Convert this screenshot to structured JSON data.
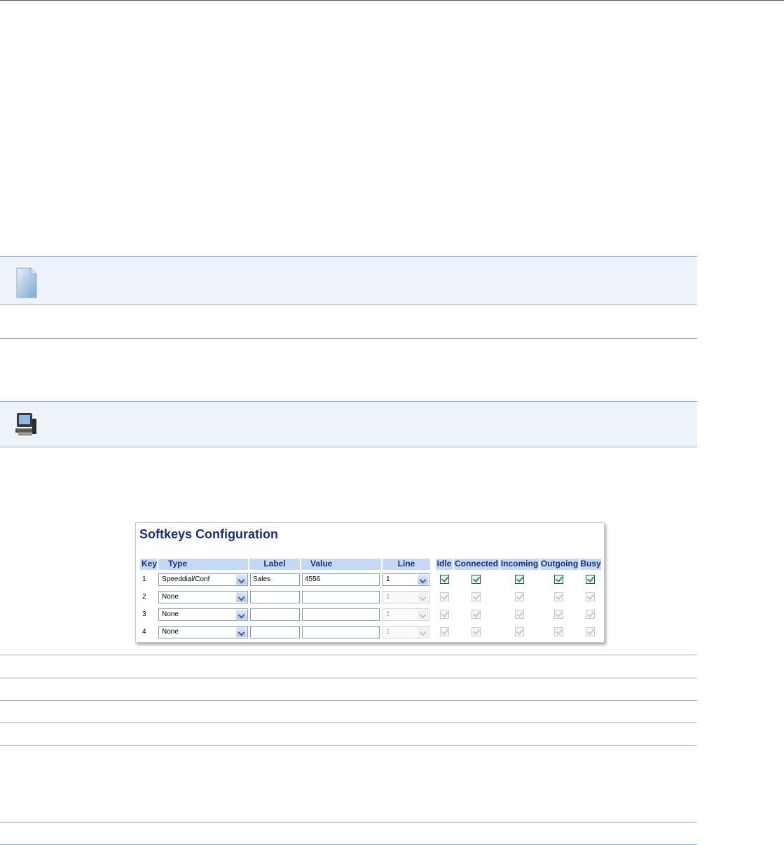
{
  "softkeys": {
    "title": "Softkeys Configuration",
    "columns": {
      "key": "Key",
      "type": "Type",
      "label": "Label",
      "value": "Value",
      "line": "Line",
      "idle": "Idle",
      "connected": "Connected",
      "incoming": "Incoming",
      "outgoing": "Outgoing",
      "busy": "Busy"
    },
    "rows": [
      {
        "key": "1",
        "type": "Speeddial/Conf",
        "label": "Sales",
        "value": "4556",
        "line": "1",
        "enabled": true,
        "idle": true,
        "connected": true,
        "incoming": true,
        "outgoing": true,
        "busy": true
      },
      {
        "key": "2",
        "type": "None",
        "label": "",
        "value": "",
        "line": "1",
        "enabled": false,
        "idle": true,
        "connected": true,
        "incoming": true,
        "outgoing": true,
        "busy": true
      },
      {
        "key": "3",
        "type": "None",
        "label": "",
        "value": "",
        "line": "1",
        "enabled": false,
        "idle": true,
        "connected": true,
        "incoming": true,
        "outgoing": true,
        "busy": true
      },
      {
        "key": "4",
        "type": "None",
        "label": "",
        "value": "",
        "line": "1",
        "enabled": false,
        "idle": true,
        "connected": true,
        "incoming": true,
        "outgoing": true,
        "busy": true
      }
    ]
  },
  "icons": {
    "note": "note-icon",
    "computer": "computer-icon"
  },
  "colors": {
    "accent": "#1a2f80",
    "header_fill": "#c5d9f5",
    "rule": "#8ab0d4",
    "band": "#eef3fa"
  }
}
